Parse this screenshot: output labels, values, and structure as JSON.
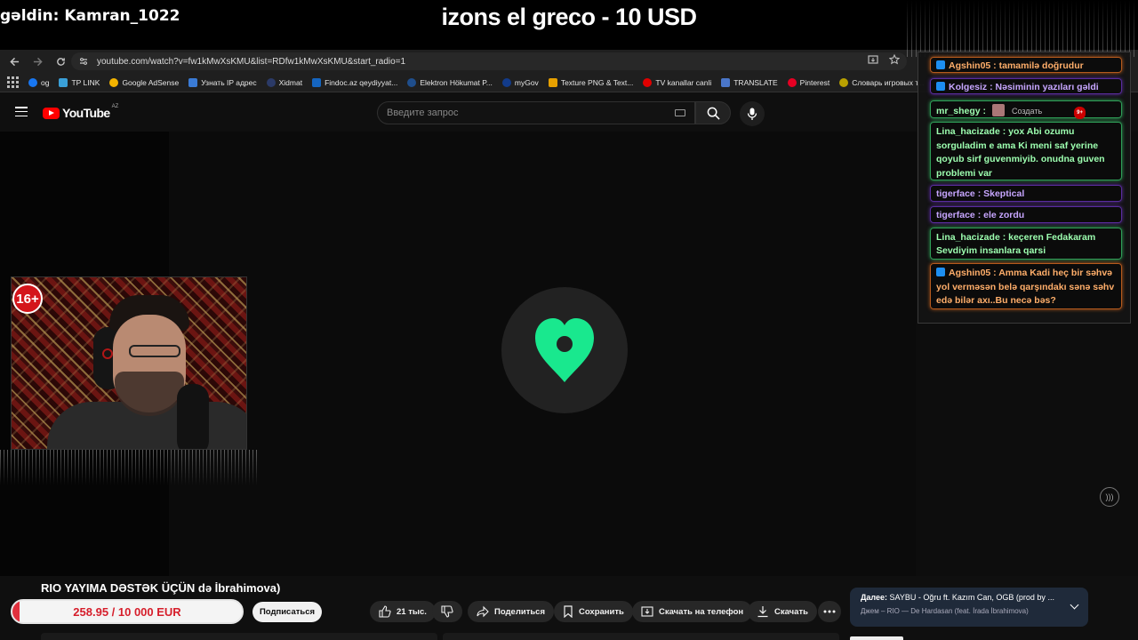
{
  "overlay": {
    "greeting": "gəldin: Kamran_1022",
    "donation": "izons el greco - 10 USD",
    "age_badge": "16+"
  },
  "browser": {
    "url": "youtube.com/watch?v=fw1kMwXsKMU&list=RDfw1kMwXsKMU&start_radio=1",
    "bookmarks": [
      {
        "label": "og",
        "color": "#1877f2"
      },
      {
        "label": "TP LINK",
        "color": "#3aa0d8"
      },
      {
        "label": "Google AdSense",
        "color": "#f4b400"
      },
      {
        "label": "Узнать IP адрес",
        "color": "#3a7bd5"
      },
      {
        "label": "Xidmat",
        "color": "#2b3a67"
      },
      {
        "label": "Findoc.az qeydiyyat...",
        "color": "#1565c0"
      },
      {
        "label": "Elektron Hökumat P...",
        "color": "#1f4e8c"
      },
      {
        "label": "myGov",
        "color": "#123b8a"
      },
      {
        "label": "Texture PNG & Text...",
        "color": "#e6a000"
      },
      {
        "label": "TV kanallar canli",
        "color": "#e00000"
      },
      {
        "label": "TRANSLATE",
        "color": "#4a76c9"
      },
      {
        "label": "Pinterest",
        "color": "#e60023"
      },
      {
        "label": "Словарь игровых т...",
        "color": "#b8a000"
      }
    ]
  },
  "youtube": {
    "logo_text": "YouTube",
    "region": "AZ",
    "search_placeholder": "Введите запрос",
    "video_title_prefix": "RIO",
    "video_title_overlay": "YAYIMA DƏSTƏK ÜÇÜN",
    "video_title_suffix": "də İbrahimova)",
    "subscribe_label": "Подписаться",
    "likes": "21 тыс.",
    "share_label": "Поделиться",
    "save_label": "Сохранить",
    "phone_label": "Скачать на телефон",
    "download_label": "Скачать",
    "next_label": "Далее:",
    "next_title": "SAYBU - Oğru ft. Kazım Can, OGB (prod by ...",
    "next_subtitle": "Джем – RIO — De Hardasan (feat. İrada İbrahimova)"
  },
  "donation_goal": {
    "text": "258.95 / 10 000 EUR",
    "fraction": 0.026
  },
  "chat": {
    "header_create": "Создать",
    "header_notif": "9+",
    "messages": [
      {
        "user": "Agshin05",
        "text": "tamamilə doğrudur",
        "style": "orange",
        "twitch": true
      },
      {
        "user": "Kolgesiz",
        "text": "Nəsiminin yazıları gəldi",
        "style": "purple",
        "twitch": true
      },
      {
        "user": "mr_shegy",
        "text": "",
        "style": "green",
        "twitch": false
      },
      {
        "user": "Lina_hacizade",
        "text": "yox Abi ozumu sorguladim e ama Ki meni saf yerine qoyub sirf guvenmiyib. onudna guven problemi var",
        "style": "green",
        "twitch": false
      },
      {
        "user": "tigerface",
        "text": "Skeptical",
        "style": "purple",
        "twitch": false
      },
      {
        "user": "tigerface",
        "text": "ele zordu",
        "style": "purple",
        "twitch": false
      },
      {
        "user": "Lina_hacizade",
        "text": "keçeren Fedakaram Sevdiyim insanlara qarsi",
        "style": "green",
        "twitch": false
      },
      {
        "user": "Agshin05",
        "text": "Amma Kadi heç bir səhvə yol verməsən belə qarşındakı sənə səhv edə bilər axı..Bu necə bəs?",
        "style": "orange",
        "twitch": true
      }
    ]
  },
  "colors": {
    "accent_heart": "#19e88e",
    "goal_red": "#e0303d",
    "yt_red": "#ff0000"
  }
}
